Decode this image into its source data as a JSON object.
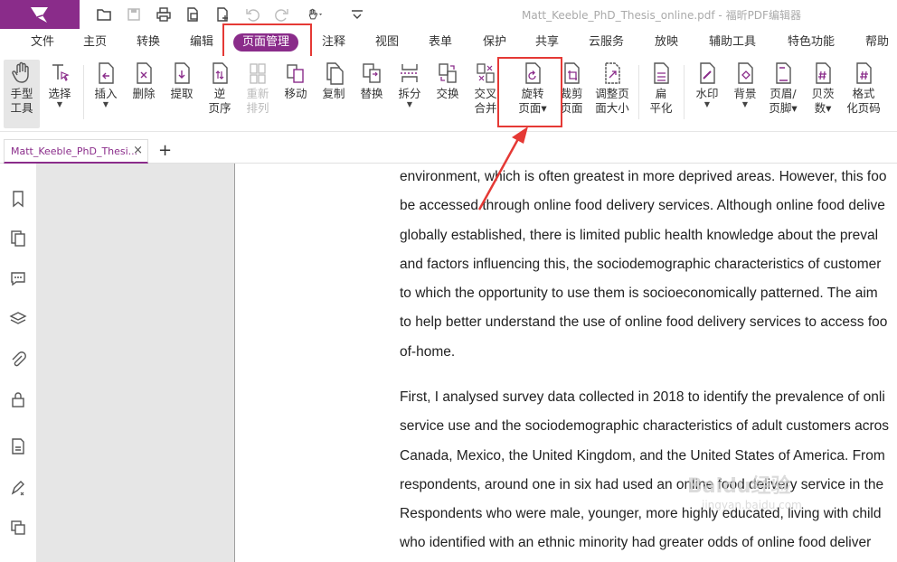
{
  "window": {
    "title": "Matt_Keeble_PhD_Thesis_online.pdf - 福昕PDF编辑器"
  },
  "menu": [
    "文件",
    "主页",
    "转换",
    "编辑",
    "页面管理",
    "注释",
    "视图",
    "表单",
    "保护",
    "共享",
    "云服务",
    "放映",
    "辅助工具",
    "特色功能",
    "帮助"
  ],
  "menu_active": "页面管理",
  "ribbon": {
    "hand": [
      "手型",
      "工具"
    ],
    "select": "选择",
    "insert": "插入",
    "delete": "删除",
    "extract": "提取",
    "reverse": [
      "逆",
      "页序"
    ],
    "rearrange": [
      "重新",
      "排列"
    ],
    "move": "移动",
    "copy": "复制",
    "replace": "替换",
    "split": "拆分",
    "swap": "交换",
    "merge": [
      "交叉",
      "合并"
    ],
    "rotate": [
      "旋转",
      "页面"
    ],
    "crop": [
      "裁剪",
      "页面"
    ],
    "resize": [
      "调整页",
      "面大小"
    ],
    "flatten": [
      "扁",
      "平化"
    ],
    "watermark": "水印",
    "background": "背景",
    "header_footer": [
      "页眉/",
      "页脚"
    ],
    "bates": [
      "贝茨",
      "数"
    ],
    "format_page_number": [
      "格式",
      "化页码"
    ]
  },
  "tab": {
    "label": "Matt_Keeble_PhD_Thesi...",
    "close": "×",
    "new": "+"
  },
  "document": {
    "para1": [
      "environment, which is often greatest in more deprived areas. However, this foo",
      "be accessed through online food delivery services. Although online food delive",
      "globally established, there is limited public health knowledge about the preval",
      "and factors influencing this, the sociodemographic characteristics of customer",
      "to which the opportunity to use them is socioeconomically patterned. The aim",
      "to help better understand the use of online food delivery services to access foo",
      "of-home."
    ],
    "para2": [
      "First, I analysed survey data collected in 2018 to identify the prevalence of onli",
      "service use and the sociodemographic characteristics of adult customers acros",
      "Canada, Mexico, the United Kingdom, and the United States of America. From",
      "respondents, around one in six had used an online food delivery service in the",
      "Respondents who were male, younger, more highly educated, living with child",
      "who identified with an ethnic minority had greater odds of online food deliver"
    ]
  },
  "watermark": {
    "text": "Baidu经验",
    "sub": "jingyan.baidu.com"
  },
  "colors": {
    "accent": "#8a2c8a",
    "highlight": "#e53935"
  }
}
